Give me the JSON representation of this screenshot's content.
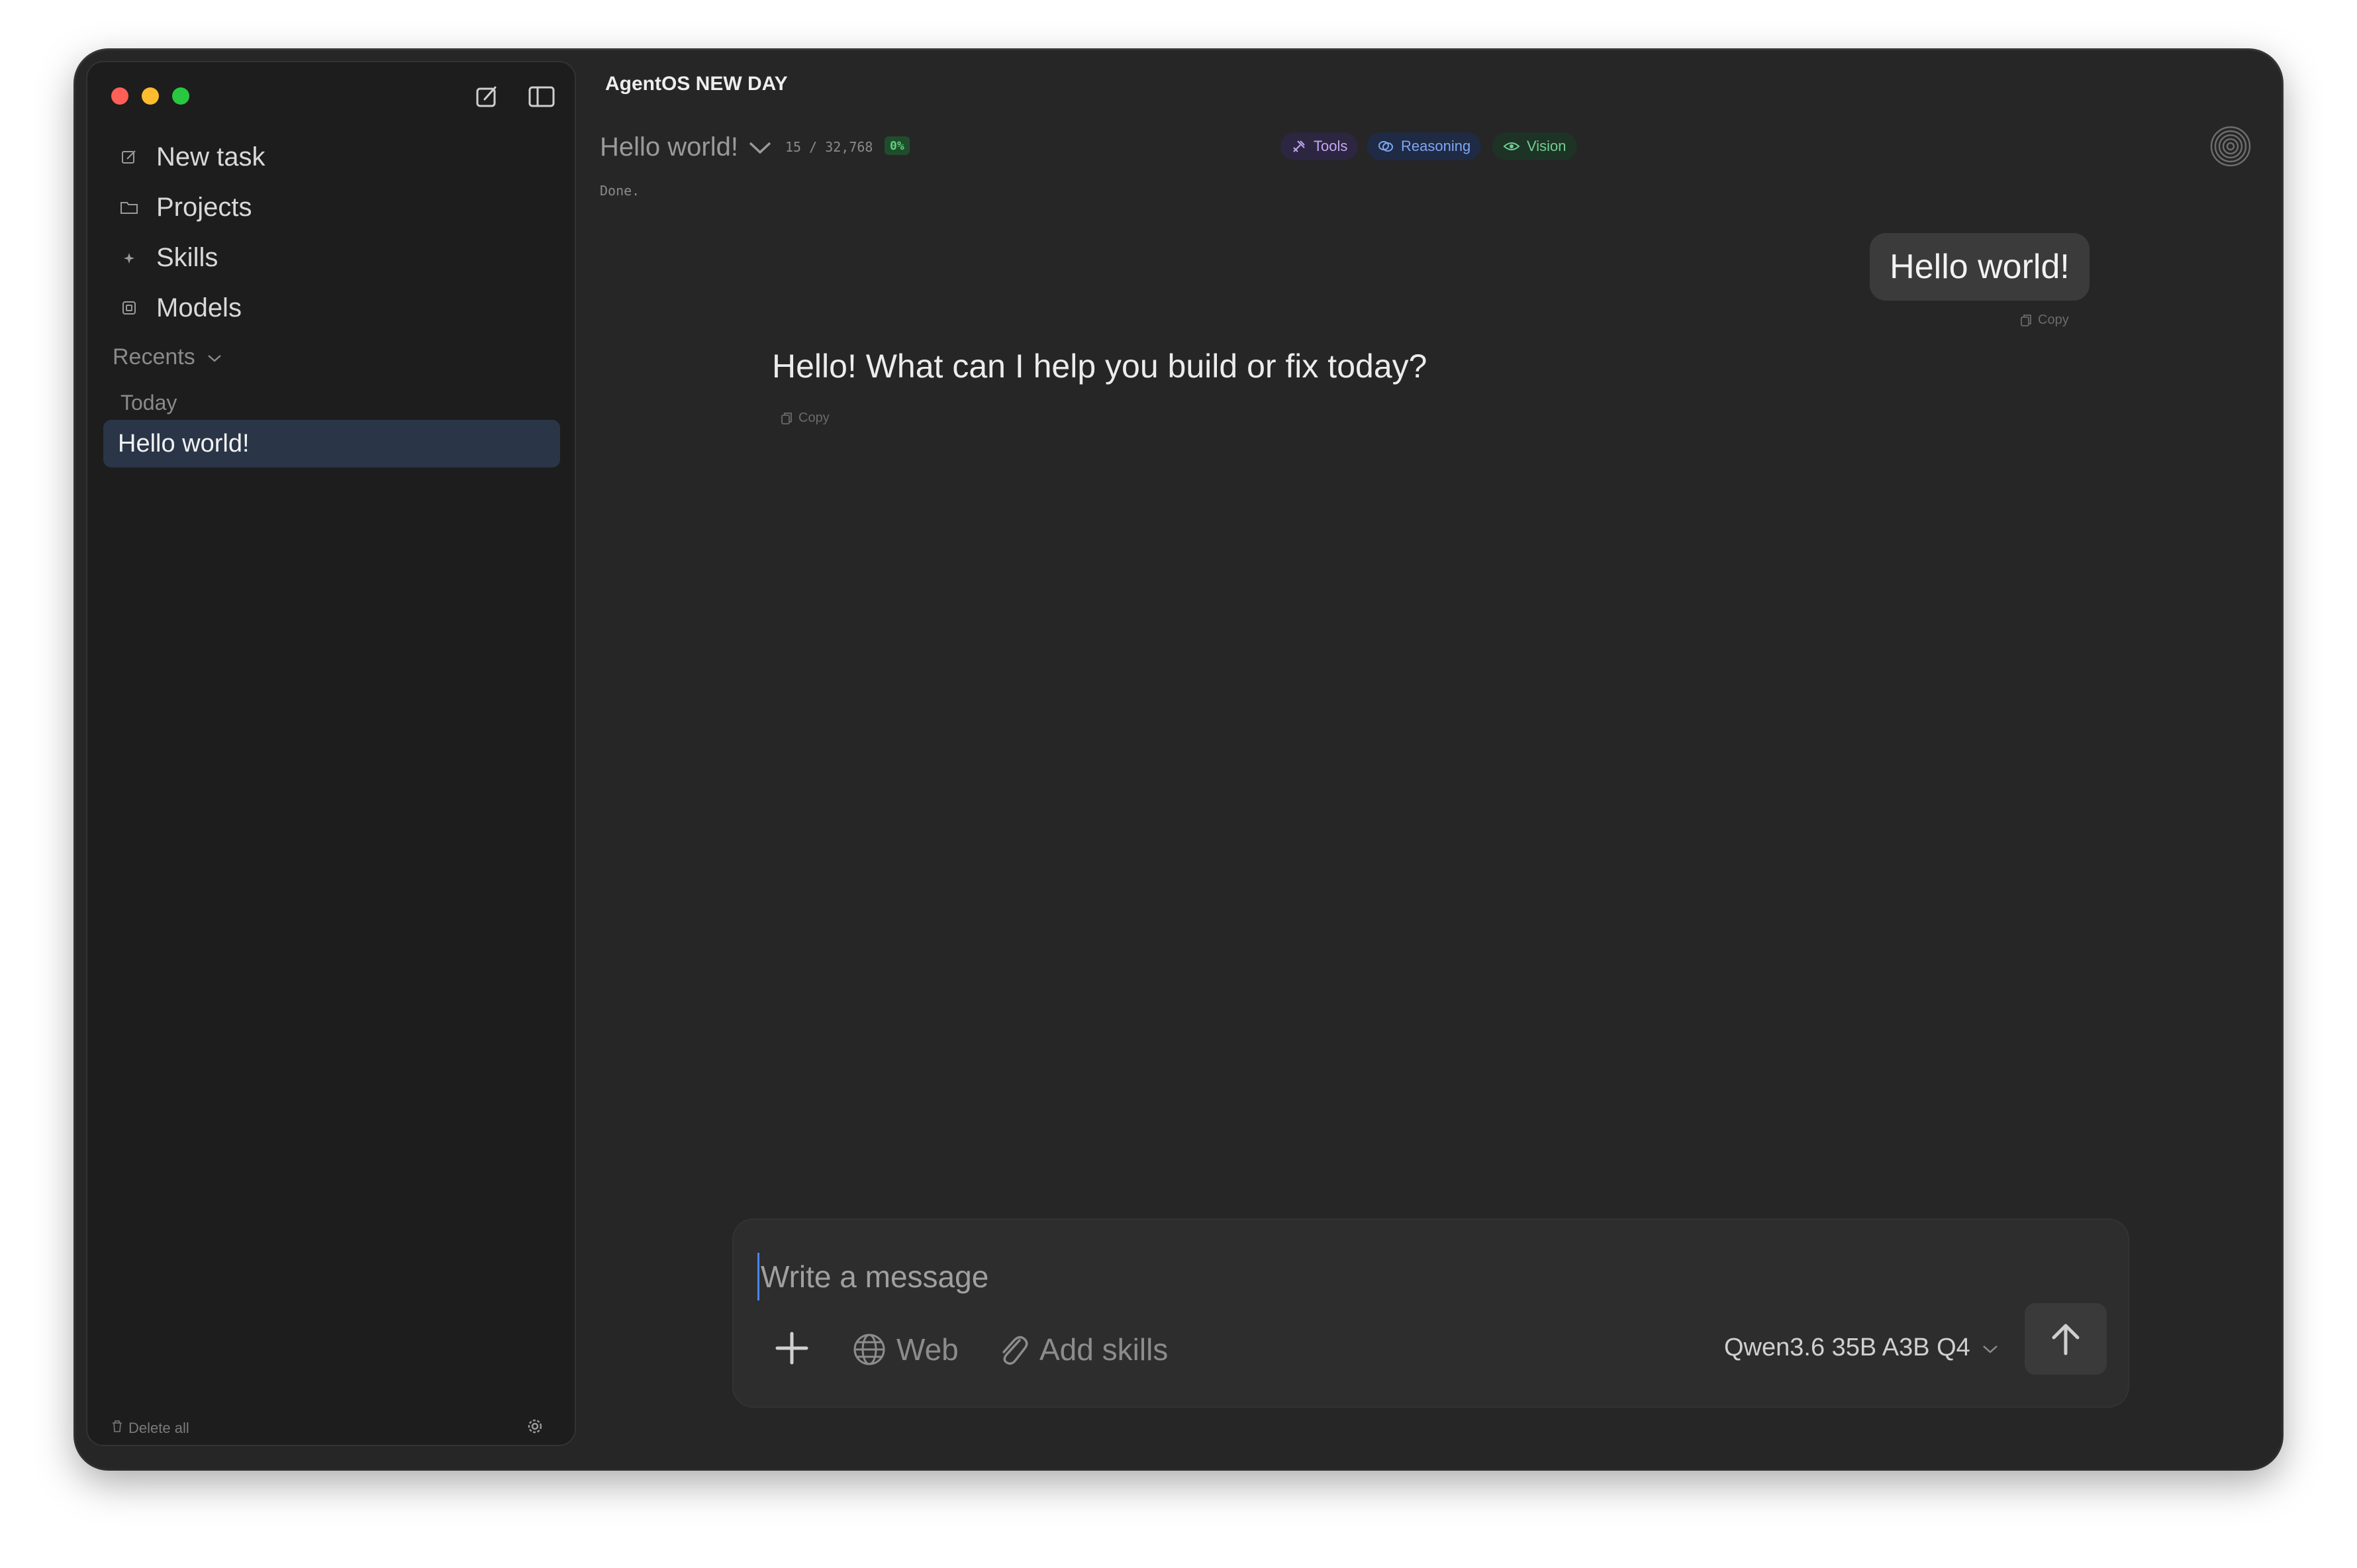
{
  "sidebar": {
    "nav": [
      {
        "label": "New task",
        "icon": "edit-icon"
      },
      {
        "label": "Projects",
        "icon": "folder-icon"
      },
      {
        "label": "Skills",
        "icon": "sparkle-icon"
      },
      {
        "label": "Models",
        "icon": "cube-icon"
      }
    ],
    "recents_label": "Recents",
    "today_label": "Today",
    "recent_items": [
      {
        "label": "Hello world!"
      }
    ],
    "delete_all_label": "Delete all"
  },
  "header": {
    "app_title": "AgentOS NEW DAY",
    "chat_title": "Hello world!",
    "token_count": "15 / 32,768",
    "token_pct": "0%",
    "status": "Done.",
    "badges": {
      "tools": "Tools",
      "reasoning": "Reasoning",
      "vision": "Vision"
    }
  },
  "messages": {
    "user_text": "Hello world!",
    "assistant_text": "Hello! What can I help you build or fix today?",
    "copy_label": "Copy"
  },
  "composer": {
    "placeholder": "Write a message",
    "web_label": "Web",
    "skills_label": "Add skills",
    "model_label": "Qwen3.6 35B A3B Q4"
  },
  "colors": {
    "background": "#262626",
    "sidebar": "#1d1d1d",
    "selected_item": "#2a3548",
    "tools_badge": "#c4a7f5",
    "reasoning_badge": "#7fa6f4",
    "vision_badge": "#6fd08e"
  }
}
